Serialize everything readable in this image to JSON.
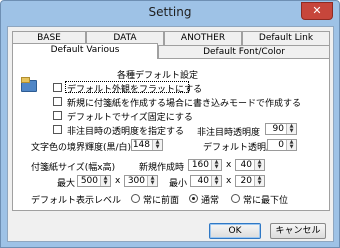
{
  "window": {
    "title": "Setting",
    "close_glyph": "✕"
  },
  "tabs_row1": [
    "BASE",
    "DATA",
    "ANOTHER",
    "Default Link"
  ],
  "tabs_row2": [
    "Default Various",
    "Default Font/Color"
  ],
  "active_tab": "Default Various",
  "panel": {
    "section_title": "各種デフォルト設定",
    "checkboxes": [
      {
        "label": "デフォルト外観をフラットにする",
        "checked": false
      },
      {
        "label": "新規に付箋紙を作成する場合に書き込みモードで作成する",
        "checked": false
      },
      {
        "label": "デフォルトでサイズ固定にする",
        "checked": false
      },
      {
        "label": "非注目時の透明度を指定する",
        "checked": false
      }
    ],
    "inactive_alpha_label": "非注目時透明度",
    "inactive_alpha_value": "90",
    "border_luma_label": "文字色の境界輝度(黒/白)",
    "border_luma_value": "148",
    "default_alpha_label": "デフォルト透明度",
    "default_alpha_value": "0",
    "size_label": "付箋紙サイズ(幅x高)",
    "new_size_label": "新規作成時",
    "new_w": "160",
    "new_h": "40",
    "max_label": "最大",
    "max_w": "500",
    "max_h": "300",
    "min_label": "最小",
    "min_w": "40",
    "min_h": "20",
    "x_sep": "x",
    "display_level_label": "デフォルト表示レベル",
    "levels": [
      {
        "label": "常に前面",
        "checked": false
      },
      {
        "label": "通常",
        "checked": true
      },
      {
        "label": "常に最下位",
        "checked": false
      }
    ]
  },
  "buttons": {
    "ok": "OK",
    "cancel": "キャンセル"
  }
}
